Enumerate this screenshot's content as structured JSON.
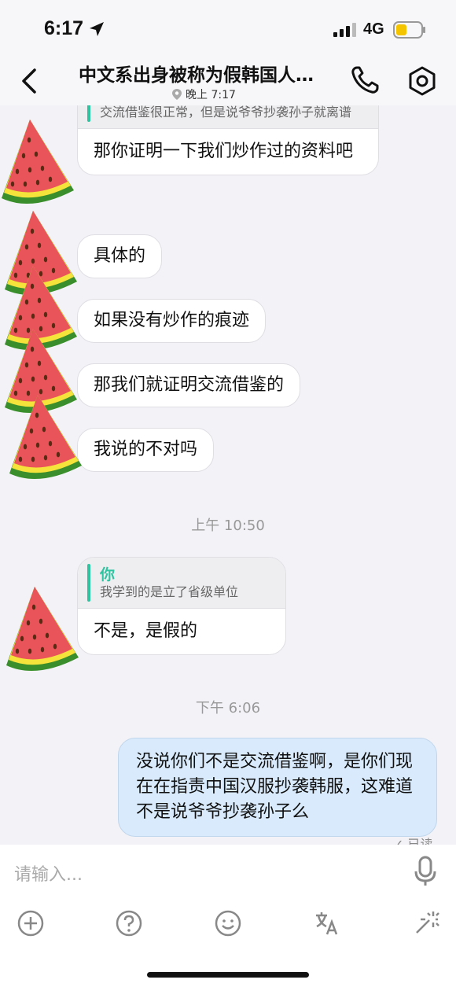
{
  "status": {
    "time": "6:17",
    "network": "4G"
  },
  "header": {
    "title": "中文系出身被称为假韩国人…",
    "subtitle": "晚上 7:17"
  },
  "messages": {
    "m1_quote": "交流借鉴很正常，但是说爷爷抄袭孙子就离谱",
    "m1_text": "那你证明一下我们炒作过的资料吧",
    "m2_text": "具体的",
    "m3_text": "如果没有炒作的痕迹",
    "m4_text": "那我们就证明交流借鉴的",
    "m5_text": "我说的不对吗",
    "sep1": "上午 10:50",
    "m6_quote_author": "你",
    "m6_quote": "我学到的是立了省级单位",
    "m6_text": "不是，是假的",
    "sep2": "下午 6:06",
    "mine_text": "没说你们不是交流借鉴啊，是你们现在在指责中国汉服抄袭韩服，这难道不是说爷爷抄袭孙子么",
    "read_status": "已读"
  },
  "input": {
    "placeholder": "请输入..."
  },
  "colors": {
    "accent": "#2ec4a0",
    "my_bubble": "#d8eafb",
    "watermelon_red": "#e8545a",
    "rind_yellow": "#f5e23a",
    "rind_green": "#3a8f2c"
  }
}
